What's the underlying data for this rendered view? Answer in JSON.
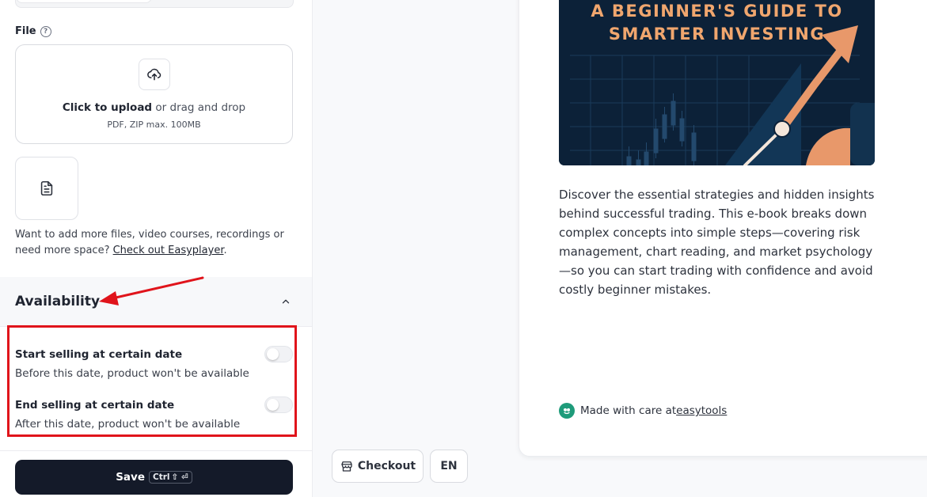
{
  "file_section": {
    "label": "File",
    "help_glyph": "?",
    "upload": {
      "click_text": "Click to upload",
      "drag_text": " or drag and drop",
      "formats": "PDF, ZIP max. 100MB"
    },
    "more_files_text": "Want to add more files, video courses, recordings or need more space? ",
    "more_files_link": "Check out Easyplayer",
    "more_files_end": "."
  },
  "availability": {
    "title": "Availability",
    "start": {
      "title": "Start selling at certain date",
      "description": "Before this date, product won't be available",
      "enabled": false
    },
    "end": {
      "title": "End selling at certain date",
      "description": "After this date, product won't be available",
      "enabled": false
    }
  },
  "save_button": {
    "label": "Save",
    "shortcut_ctrl": "Ctrl",
    "shortcut_rest": "⇧ ⏎"
  },
  "footer_buttons": {
    "checkout_label": "Checkout",
    "language_label": "EN"
  },
  "preview": {
    "cover_title_line1": "A BEGINNER'S GUIDE TO",
    "cover_title_line2": "SMARTER INVESTING",
    "description": "Discover the essential strategies and hidden insights behind successful trading. This e-book breaks down complex concepts into simple steps—covering risk management, chart reading, and market psychology—so you can start trading with confidence and avoid costly beginner mistakes.",
    "made_with_text": "Made with care at ",
    "made_with_link": "easytools"
  },
  "colors": {
    "accent_dark": "#141a29",
    "annotation_red": "#e0141b",
    "cover_bg": "#0c2138",
    "cover_orange": "#f0a66e",
    "brand_green": "#1e9b7a"
  },
  "icons": {
    "help": "help-circle-icon",
    "upload": "cloud-upload-icon",
    "file": "file-text-icon",
    "chevron": "chevron-up-icon",
    "checkout": "checkout-icon",
    "logo": "easytools-logo-icon"
  }
}
